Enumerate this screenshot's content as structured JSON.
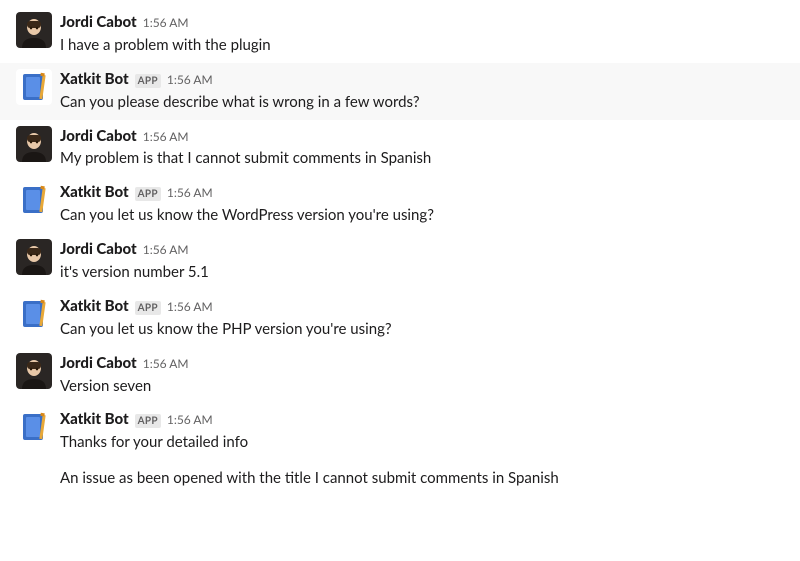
{
  "app_badge_label": "APP",
  "messages": [
    {
      "author": "Jordi Cabot",
      "is_app": false,
      "timestamp": "1:56 AM",
      "text": "I have a problem with the plugin",
      "highlighted": false,
      "avatar": "user"
    },
    {
      "author": "Xatkit Bot",
      "is_app": true,
      "timestamp": "1:56 AM",
      "text": "Can you please describe what is wrong in a few words?",
      "highlighted": true,
      "avatar": "bot"
    },
    {
      "author": "Jordi Cabot",
      "is_app": false,
      "timestamp": "1:56 AM",
      "text": "My problem is that I cannot submit comments in Spanish",
      "highlighted": false,
      "avatar": "user"
    },
    {
      "author": "Xatkit Bot",
      "is_app": true,
      "timestamp": "1:56 AM",
      "text": "Can you let us know the WordPress version you're using?",
      "highlighted": false,
      "avatar": "bot"
    },
    {
      "author": "Jordi Cabot",
      "is_app": false,
      "timestamp": "1:56 AM",
      "text": "it's version number 5.1",
      "highlighted": false,
      "avatar": "user"
    },
    {
      "author": "Xatkit Bot",
      "is_app": true,
      "timestamp": "1:56 AM",
      "text": "Can you let us know the PHP version you're using?",
      "highlighted": false,
      "avatar": "bot"
    },
    {
      "author": "Jordi Cabot",
      "is_app": false,
      "timestamp": "1:56 AM",
      "text": "Version seven",
      "highlighted": false,
      "avatar": "user"
    },
    {
      "author": "Xatkit Bot",
      "is_app": true,
      "timestamp": "1:56 AM",
      "text": "Thanks for your detailed info",
      "text2": "An issue as been opened with the title I cannot submit comments in Spanish",
      "highlighted": false,
      "avatar": "bot"
    }
  ]
}
